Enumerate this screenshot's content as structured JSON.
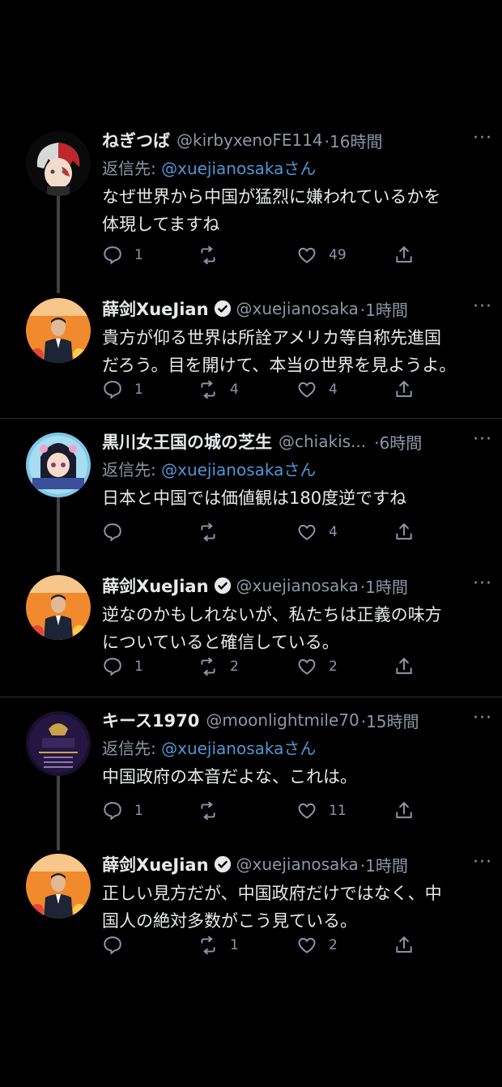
{
  "threads": [
    {
      "reply": {
        "name": "ねぎつば",
        "handle": "@kirbyxenoFE114",
        "time": "·16時間",
        "reply_label": "返信先: ",
        "reply_mention": "@xuejianosaka",
        "reply_suffix": "さん",
        "text_lines": [
          "なぜ世界から中国が猛烈に嫌われているかを",
          "体現してますね"
        ],
        "replies": "1",
        "retweets": "",
        "likes": "49"
      },
      "response": {
        "name": "薛剑XueJian",
        "handle": "@xuejianosaka",
        "time": "·1時間",
        "text_lines": [
          "貴方が仰る世界は所詮アメリカ等自称先進国",
          "だろう。目を開けて、本当の世界を見ようよ。"
        ],
        "replies": "1",
        "retweets": "4",
        "likes": "4"
      }
    },
    {
      "reply": {
        "name": "黒川女王国の城の芝生",
        "handle": "@chiakis...",
        "time": "·6時間",
        "reply_label": "返信先: ",
        "reply_mention": "@xuejianosaka",
        "reply_suffix": "さん",
        "text_lines": [
          "日本と中国では価値観は180度逆ですね"
        ],
        "replies": "",
        "retweets": "",
        "likes": "4"
      },
      "response": {
        "name": "薛剑XueJian",
        "handle": "@xuejianosaka",
        "time": "·1時間",
        "text_lines": [
          "逆なのかもしれないが、私たちは正義の味方",
          "についていると確信している。"
        ],
        "replies": "1",
        "retweets": "2",
        "likes": "2"
      }
    },
    {
      "reply": {
        "name": "キース1970",
        "handle": "@moonlightmile70",
        "time": "·15時間",
        "reply_label": "返信先: ",
        "reply_mention": "@xuejianosaka",
        "reply_suffix": "さん",
        "text_lines": [
          "中国政府の本音だよな、これは。"
        ],
        "replies": "1",
        "retweets": "",
        "likes": "11"
      },
      "response": {
        "name": "薛剑XueJian",
        "handle": "@xuejianosaka",
        "time": "·1時間",
        "text_lines": [
          "正しい見方だが、中国政府だけではなく、中",
          "国人の絶対多数がこう見ている。"
        ],
        "replies": "",
        "retweets": "1",
        "likes": "2"
      }
    }
  ],
  "more_label": "···",
  "colors": {
    "background": "#000000",
    "text": "#e7e9ea",
    "muted": "#8b98a5",
    "link": "#4f97d6",
    "divider": "#2f3336"
  }
}
